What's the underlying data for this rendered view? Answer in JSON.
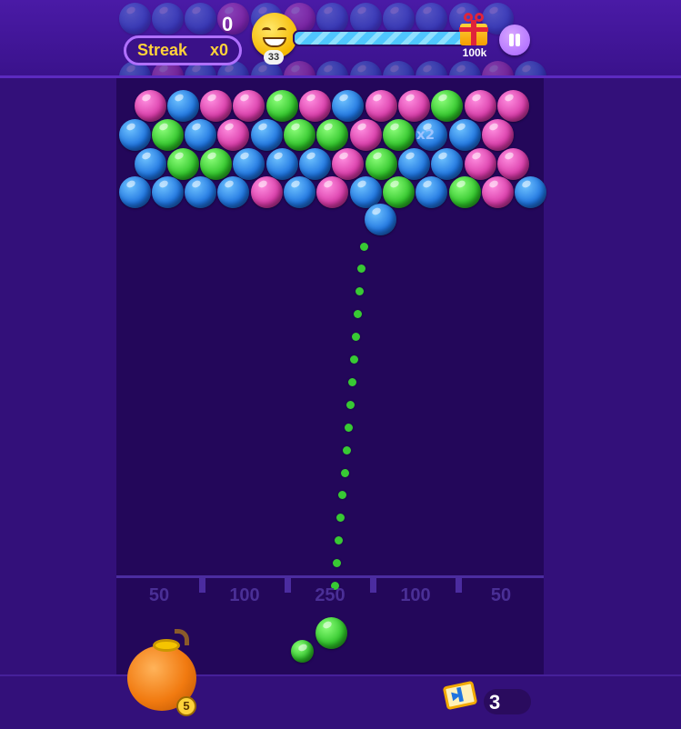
{
  "hud": {
    "score": "0",
    "streak_label": "Streak",
    "streak_value": "x0",
    "level": "33",
    "progress": 1.0,
    "reward_label": "100k"
  },
  "board": {
    "rows": [
      [
        "pink",
        "blue",
        "pink",
        "pink",
        "green",
        "pink",
        "blue",
        "pink",
        "pink",
        "green",
        "pink",
        "pink"
      ],
      [
        "blue",
        "green",
        "blue",
        "pink",
        "blue",
        "green",
        "green",
        "pink",
        "green",
        "blue",
        "blue",
        "pink"
      ],
      [
        "blue",
        "green",
        "green",
        "blue",
        "blue",
        "blue",
        "pink",
        "green",
        "blue",
        "blue",
        "pink",
        "pink"
      ],
      [
        "blue",
        "blue",
        "blue",
        "blue",
        "pink",
        "blue",
        "pink",
        "blue",
        "green",
        "blue",
        "green",
        "pink",
        "blue"
      ]
    ],
    "multiplier_label": "x2",
    "hanging_bubble": "blue"
  },
  "shooter": {
    "current_bubble": "green",
    "next_bubble": "green"
  },
  "score_zones": [
    "50",
    "100",
    "250",
    "100",
    "50"
  ],
  "boosters": {
    "bomb_count": "5",
    "swap_count": "3"
  }
}
